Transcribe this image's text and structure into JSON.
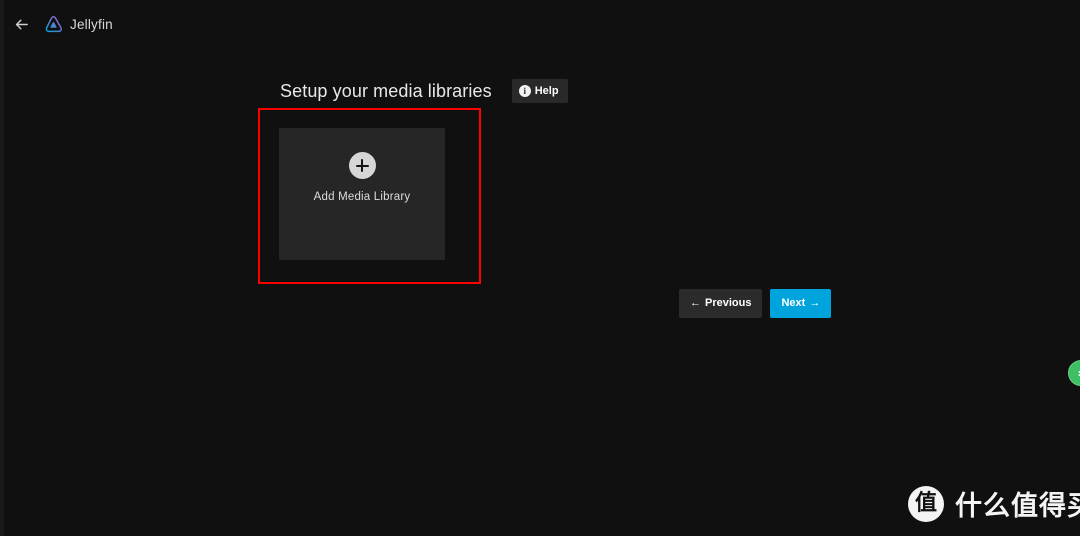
{
  "header": {
    "back_icon": "arrow-left-icon",
    "brand_name": "Jellyfin",
    "brand_logo_icon": "jellyfin-logo-icon",
    "brand_gradient_start": "#AA5CC3",
    "brand_gradient_end": "#00A4DC"
  },
  "main": {
    "page_title": "Setup your media libraries",
    "help_label": "Help",
    "help_icon": "info-circle-icon",
    "card": {
      "add_icon": "plus-circle-icon",
      "label": "Add Media Library"
    },
    "annotation": {
      "name": "red-highlight-box",
      "color": "#FE0000"
    }
  },
  "navigation": {
    "previous_label": "Previous",
    "previous_arrow": "←",
    "next_label": "Next",
    "next_arrow": "→",
    "next_color": "#00A4DC",
    "previous_color": "#2B2B2B"
  },
  "overlays": {
    "green_badge": {
      "name": "floating-green-button",
      "color": "#3FBF63",
      "glyph": "ກ"
    },
    "watermark": {
      "logo_glyph": "值",
      "text": "什么值得买"
    }
  },
  "theme": {
    "background": "#101010",
    "card_background": "#262626",
    "text_primary": "#E8E8E8",
    "accent": "#00A4DC"
  }
}
